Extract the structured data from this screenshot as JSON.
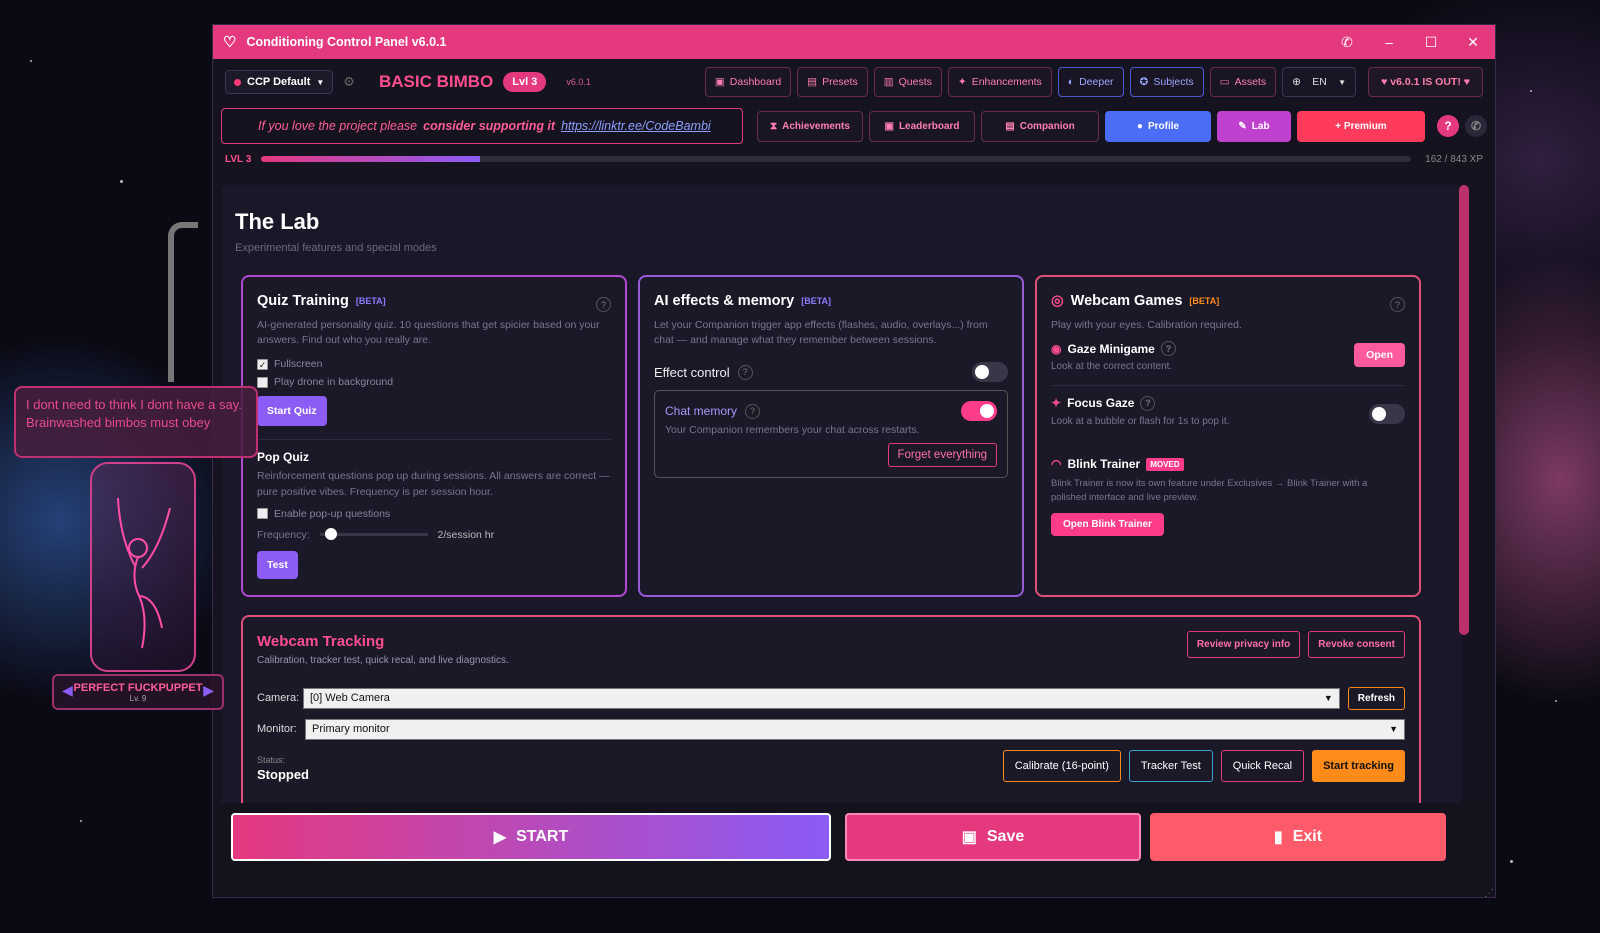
{
  "window": {
    "title": "Conditioning Control Panel v6.0.1"
  },
  "top": {
    "preset": "CCP Default",
    "brand": "BASIC BIMBO",
    "level_pill": "Lvl 3",
    "version": "v6.0.1",
    "nav": [
      "Dashboard",
      "Presets",
      "Quests",
      "Enhancements",
      "Deeper",
      "Subjects",
      "Assets"
    ],
    "language": "EN",
    "new_version": "v6.0.1 IS OUT!"
  },
  "support": {
    "prefix": "If you love the project please",
    "emph": "consider supporting it",
    "link": "https://linktr.ee/CodeBambi"
  },
  "tabs": [
    "Achievements",
    "Leaderboard",
    "Companion",
    "Profile",
    "Lab",
    "+ Premium"
  ],
  "help_label": "?",
  "xp": {
    "level": "LVL 3",
    "text": "162 / 843 XP",
    "progress": 0.19
  },
  "lab": {
    "title": "The Lab",
    "subtitle": "Experimental features and special modes"
  },
  "quiz": {
    "title": "Quiz Training",
    "badge": "[BETA]",
    "desc": "AI-generated personality quiz. 10 questions that get spicier based on your answers. Find out who you really are.",
    "fullscreen": "Fullscreen",
    "drone": "Play drone in background",
    "start_btn": "Start Quiz",
    "pop_title": "Pop Quiz",
    "pop_desc": "Reinforcement questions pop up during sessions. All answers are correct — pure positive vibes. Frequency is per session hour.",
    "enable": "Enable pop-up questions",
    "freq_label": "Frequency:",
    "freq_value": "2/session hr",
    "freq_level": 0.05,
    "test_btn": "Test"
  },
  "ai": {
    "title": "AI effects & memory",
    "badge": "[BETA]",
    "desc": "Let your Companion trigger app effects (flashes, audio, overlays...) from chat — and manage what they remember between sessions.",
    "effect_label": "Effect control",
    "memory_title": "Chat memory",
    "memory_desc": "Your Companion remembers your chat across restarts.",
    "forget_btn": "Forget everything"
  },
  "webcam_games": {
    "title": "Webcam Games",
    "badge": "[BETA]",
    "desc": "Play with your eyes. Calibration required.",
    "gaze_title": "Gaze Minigame",
    "gaze_desc": "Look at the correct content.",
    "open_btn": "Open",
    "focus_title": "Focus Gaze",
    "focus_desc": "Look at a bubble or flash for 1s to pop it.",
    "blink_title": "Blink Trainer",
    "blink_badge": "MOVED",
    "blink_desc": "Blink Trainer is now its own feature under Exclusives → Blink Trainer with a polished interface and live preview.",
    "blink_btn": "Open Blink Trainer"
  },
  "tracking": {
    "title": "Webcam Tracking",
    "desc": "Calibration, tracker test, quick recal, and live diagnostics.",
    "privacy_btn": "Review privacy info",
    "revoke_btn": "Revoke consent",
    "camera_label": "Camera:",
    "camera_value": "[0] Web Camera",
    "refresh_btn": "Refresh",
    "monitor_label": "Monitor:",
    "monitor_value": "Primary monitor",
    "status_label": "Status:",
    "status_value": "Stopped",
    "calibrate_btn": "Calibrate (16-point)",
    "tracker_btn": "Tracker Test",
    "recal_btn": "Quick Recal",
    "start_btn": "Start tracking"
  },
  "footer": {
    "start": "START",
    "save": "Save",
    "exit": "Exit"
  },
  "companion": {
    "speech": "I dont need to think I dont have a say. Brainwashed bimbos must obey",
    "name": "PERFECT FUCKPUPPET",
    "level": "Lv. 9"
  },
  "colors": {
    "accent": "#e5397f",
    "purple": "#8b5cf6",
    "orange": "#ff8c1a",
    "blue": "#4a6cf7"
  }
}
